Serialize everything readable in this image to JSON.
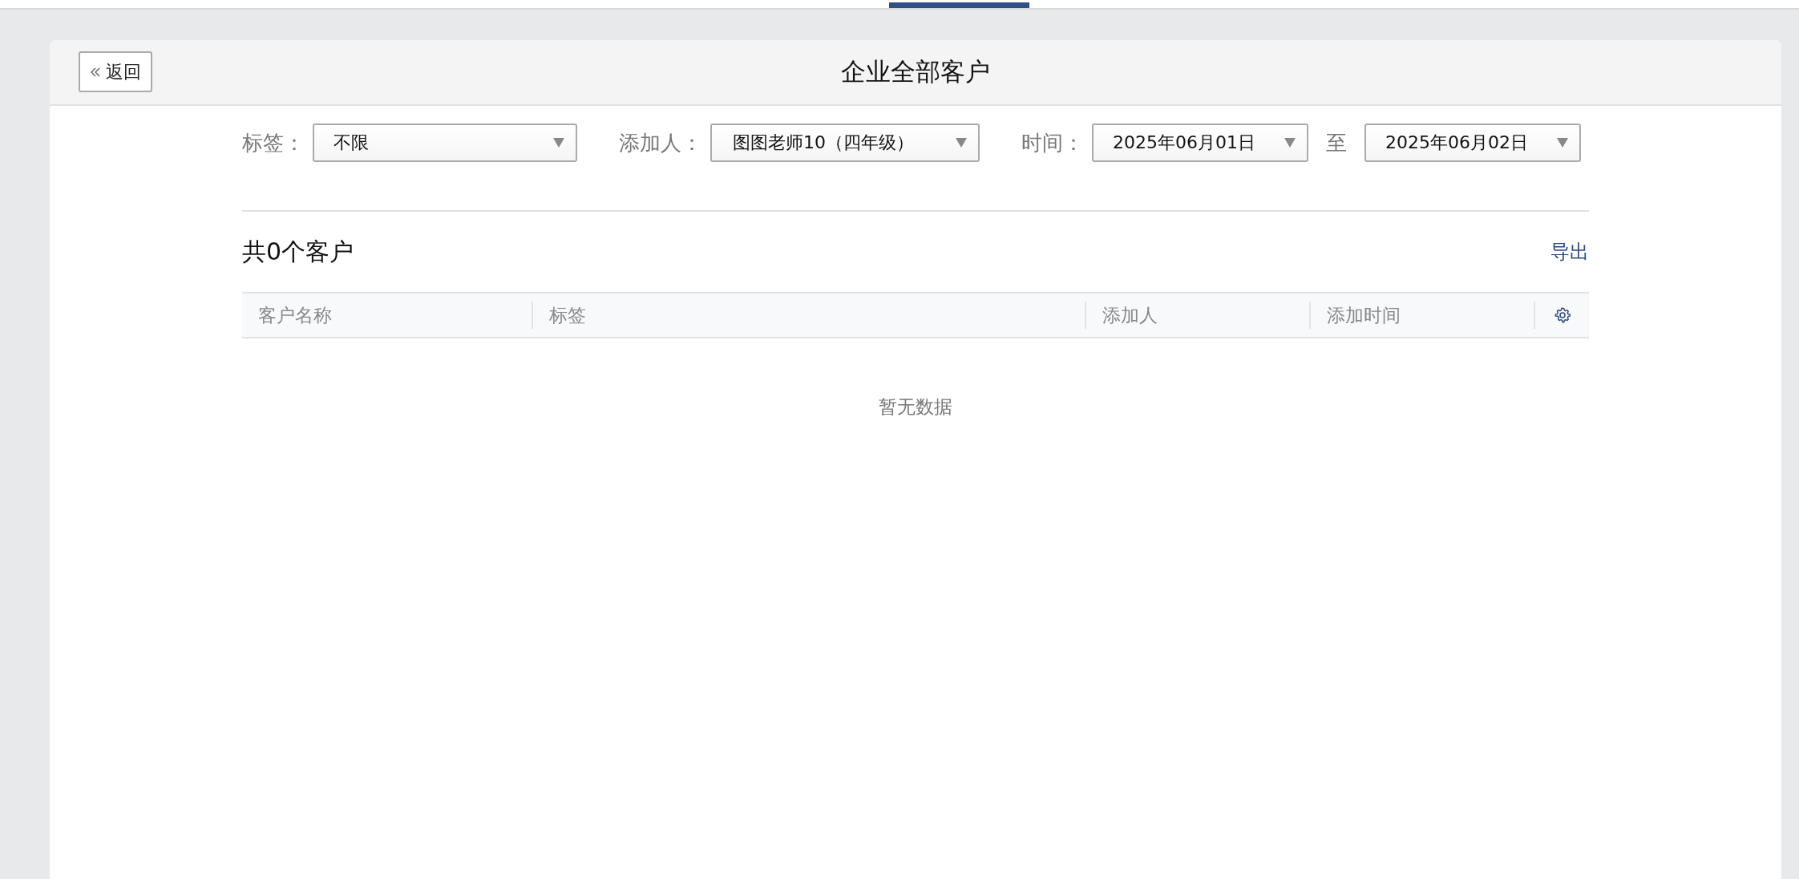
{
  "header": {
    "back_button": "返回",
    "title": "企业全部客户"
  },
  "filters": {
    "tag": {
      "label": "标签：",
      "value": "不限"
    },
    "adder": {
      "label": "添加人：",
      "value": "图图老师10（四年级）"
    },
    "time": {
      "label": "时间：",
      "from": "2025年06月01日",
      "separator": "至",
      "to": "2025年06月02日"
    }
  },
  "summary": {
    "count_text": "共0个客户",
    "export_link": "导出"
  },
  "table": {
    "columns": [
      "客户名称",
      "标签",
      "添加人",
      "添加时间"
    ],
    "empty_text": "暂无数据"
  }
}
